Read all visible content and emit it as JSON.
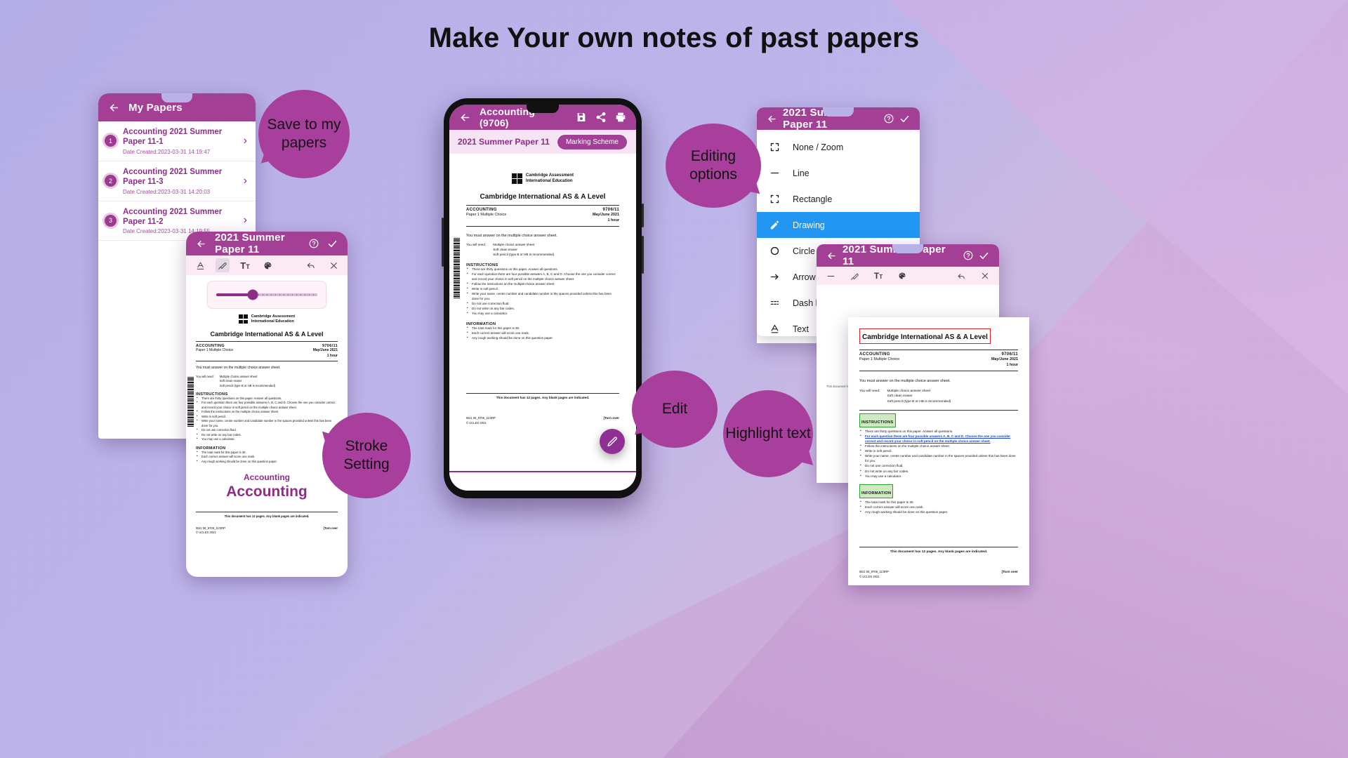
{
  "headline": "Make Your own notes of past papers",
  "colors": {
    "brand": "#a43f96",
    "brand_dark": "#8d2d86",
    "selected": "#2196f3",
    "bubble": "#a83f9c",
    "highlight_red": "#e02020",
    "highlight_green": "#2aa12a",
    "highlight_blue": "#1b44d6"
  },
  "my_papers": {
    "title": "My Papers",
    "back_icon": "arrow-left-icon",
    "items": [
      {
        "num": "1",
        "title": "Accounting 2021 Summer Paper 11-1",
        "date": "Date Created:2023-03-31 14:19:47"
      },
      {
        "num": "2",
        "title": "Accounting 2021 Summer Paper 11-3",
        "date": "Date Created:2023-03-31 14:20:03"
      },
      {
        "num": "3",
        "title": "Accounting 2021 Summer Paper 11-2",
        "date": "Date Created:2023-03-31 14:19:55"
      }
    ]
  },
  "stroke_phone": {
    "title": "2021 Summer Paper 11",
    "help_icon": "help-circle-icon",
    "check_icon": "check-icon",
    "tools": [
      "text-underline-icon",
      "brush-icon",
      "font-size-icon",
      "palette-icon"
    ],
    "undo_icon": "undo-icon",
    "close_icon": "close-icon",
    "slider_value": "36",
    "ink_small": "Accounting",
    "ink_large": "Accounting"
  },
  "center_phone": {
    "title": "Accounting (9706)",
    "back_icon": "arrow-left-icon",
    "save_icon": "save-icon",
    "share_icon": "share-icon",
    "print_icon": "print-icon",
    "sheet_title": "2021 Summer Paper 11",
    "marking_scheme_label": "Marking Scheme",
    "fab_icon": "pencil-icon"
  },
  "menu_phone": {
    "title": "2021 Summer Paper 11",
    "help_icon": "help-circle-icon",
    "check_icon": "check-icon",
    "undo_icon": "undo-icon",
    "close_icon": "close-icon",
    "items": [
      {
        "label": "None / Zoom",
        "icon": "fullscreen-icon",
        "selected": false
      },
      {
        "label": "Line",
        "icon": "line-icon",
        "selected": false
      },
      {
        "label": "Rectangle",
        "icon": "rectangle-icon",
        "selected": false
      },
      {
        "label": "Drawing",
        "icon": "pencil-icon",
        "selected": true
      },
      {
        "label": "Circle",
        "icon": "circle-icon",
        "selected": false
      },
      {
        "label": "Arrow",
        "icon": "arrow-right-icon",
        "selected": false
      },
      {
        "label": "Dash line",
        "icon": "dash-line-icon",
        "selected": false
      },
      {
        "label": "Text",
        "icon": "text-underline-icon",
        "selected": false
      }
    ]
  },
  "highlight_phone": {
    "title": "2021 Summer Paper 11",
    "help_icon": "help-circle-icon",
    "check_icon": "check-icon",
    "tools": [
      "line-icon",
      "brush-icon",
      "font-size-icon",
      "palette-icon"
    ],
    "undo_icon": "undo-icon",
    "close_icon": "close-icon"
  },
  "document": {
    "org_line1": "Cambridge Assessment",
    "org_line2": "International Education",
    "heading": "Cambridge International AS & A Level",
    "subject": "ACCOUNTING",
    "paper": "Paper 1 Multiple Choice",
    "code": "9706/11",
    "session": "May/June 2021",
    "duration": "1 hour",
    "answer_note": "You must answer on the multiple choice answer sheet.",
    "need_label": "You will need:",
    "need_items": [
      "Multiple choice answer sheet",
      "Soft clean eraser",
      "Soft pencil (type B or HB is recommended)"
    ],
    "instructions_title": "INSTRUCTIONS",
    "instructions": [
      "There are thirty questions on this paper. Answer all questions.",
      "For each question there are four possible answers A, B, C and D. Choose the one you consider correct and record your choice in soft pencil on the multiple choice answer sheet.",
      "Follow the instructions on the multiple choice answer sheet.",
      "Write in soft pencil.",
      "Write your name, centre number and candidate number in the spaces provided unless this has been done for you.",
      "Do not use correction fluid.",
      "Do not write on any bar codes.",
      "You may use a calculator."
    ],
    "information_title": "INFORMATION",
    "information": [
      "The total mark for this paper is 30.",
      "Each correct answer will score one mark.",
      "Any rough working should be done on this question paper."
    ],
    "footer_note": "This document has 12 pages. Any blank pages are indicated.",
    "footer_code1": "IB21 06_9706_11/3RP",
    "footer_code2": "© UCLES 2021",
    "turn_over": "[Turn over"
  },
  "bubbles": {
    "save": "Save to my papers",
    "editing": "Editing options",
    "stroke": "Stroke Setting",
    "edit": "Edit",
    "highlight": "Highlight text"
  }
}
